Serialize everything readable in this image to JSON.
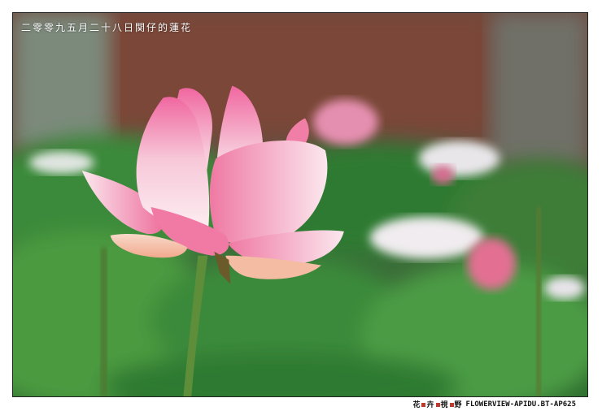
{
  "caption": "二零零九五月二十八日関仔的蓮花",
  "footer": {
    "logo_chars": [
      "花",
      "卉",
      "視",
      "野"
    ],
    "site_text": "FLOWERVIEW-APIDU.BT-AP625"
  },
  "colors": {
    "background": "#ffffff",
    "wall": "#7a4a3a",
    "leaf": "#3f8a3a",
    "petal_pink": "#f06a9a",
    "petal_white": "#fbeef2"
  }
}
